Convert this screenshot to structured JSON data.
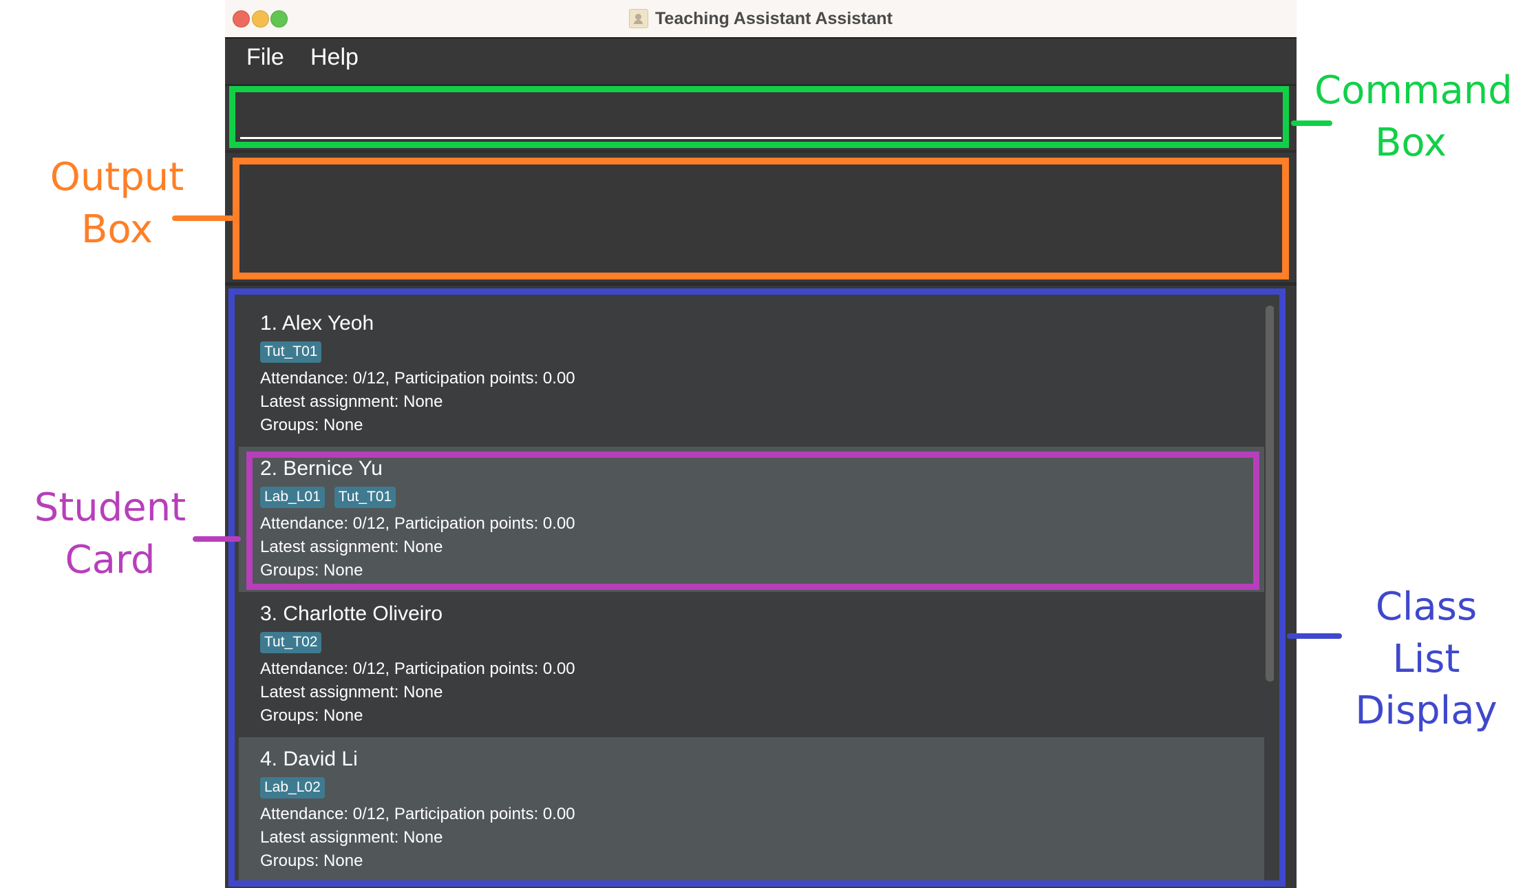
{
  "window": {
    "title": "Teaching Assistant Assistant",
    "controls": [
      "close",
      "minimize",
      "maximize"
    ]
  },
  "menu": {
    "items": [
      {
        "label": "File"
      },
      {
        "label": "Help"
      }
    ]
  },
  "command_box": {
    "value": "",
    "placeholder": ""
  },
  "output_box": {
    "text": ""
  },
  "class_list": {
    "students": [
      {
        "index": "1.",
        "name": "Alex Yeoh",
        "title": "1.  Alex Yeoh",
        "tags": [
          "Tut_T01"
        ],
        "attendance_line": "Attendance: 0/12, Participation points: 0.00",
        "assignment_line": "Latest assignment: None",
        "groups_line": "Groups: None"
      },
      {
        "index": "2.",
        "name": "Bernice Yu",
        "title": "2.  Bernice Yu",
        "tags": [
          "Lab_L01",
          "Tut_T01"
        ],
        "attendance_line": "Attendance: 0/12, Participation points: 0.00",
        "assignment_line": "Latest assignment: None",
        "groups_line": "Groups: None"
      },
      {
        "index": "3.",
        "name": "Charlotte Oliveiro",
        "title": "3.  Charlotte Oliveiro",
        "tags": [
          "Tut_T02"
        ],
        "attendance_line": "Attendance: 0/12, Participation points: 0.00",
        "assignment_line": "Latest assignment: None",
        "groups_line": "Groups: None"
      },
      {
        "index": "4.",
        "name": "David Li",
        "title": "4.  David Li",
        "tags": [
          "Lab_L02"
        ],
        "attendance_line": "Attendance: 0/12, Participation points: 0.00",
        "assignment_line": "Latest assignment: None",
        "groups_line": "Groups: None"
      }
    ]
  },
  "annotations": {
    "command_box": {
      "line1": "Command",
      "line2": "Box",
      "color": "#11d048"
    },
    "output_box": {
      "line1": "Output",
      "line2": "Box",
      "color": "#fe7f27"
    },
    "student_card": {
      "line1": "Student",
      "line2": "Card",
      "color": "#b73fbb"
    },
    "class_list": {
      "line1": "Class List",
      "line2": "Display",
      "color": "#3f48cc"
    }
  },
  "colors": {
    "app_background": "#383838",
    "card_odd": "#3c3d3f",
    "card_even": "#515658",
    "tag": "#3e7b91"
  }
}
